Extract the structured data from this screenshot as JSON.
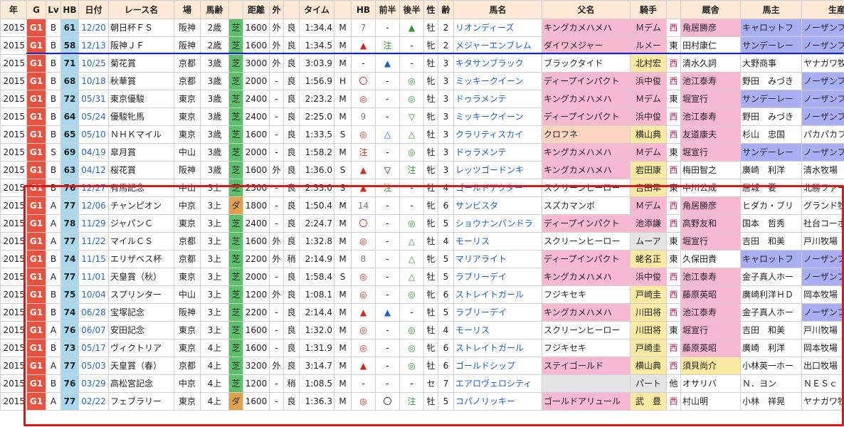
{
  "headers": [
    "年",
    "G",
    "Lv",
    "HB",
    "日付",
    "レース名",
    "場",
    "馬齢",
    "",
    "距離",
    "外",
    "",
    "タイム",
    "",
    "HB",
    "前半",
    "後半",
    "性",
    "齢",
    "馬名",
    "父名",
    "騎手",
    "",
    "厩舎",
    "馬主",
    "生産"
  ],
  "rows": [
    [
      "2015",
      "G1",
      "B",
      "61",
      "12/20",
      "朝日杯ＦＳ",
      "阪神",
      "2歳",
      "芝",
      "1600",
      "外",
      "良",
      "1:34.4",
      "M",
      "7",
      "-",
      "▲",
      "牡",
      "2",
      "リオンディーズ",
      "キングカメハメハ",
      "Ｍデム",
      "西",
      "角居勝彦",
      "キャロットフ",
      "ノーザンファ"
    ],
    [
      "2015",
      "G1",
      "B",
      "58",
      "12/13",
      "阪神ＪＦ",
      "阪神",
      "2歳",
      "芝",
      "1600",
      "外",
      "良",
      "1:34.5",
      "M",
      "▲",
      "注",
      "-",
      "牝",
      "2",
      "メジャーエンブレム",
      "ダイワメジャー",
      "ルメー",
      "東",
      "田村康仁",
      "サンデーレー",
      "ノーザンファ"
    ],
    [
      "2015",
      "G1",
      "B",
      "71",
      "10/25",
      "菊花賞",
      "京都",
      "3歳",
      "芝",
      "3000",
      "外",
      "良",
      "3:03.9",
      "M",
      "-",
      "▲",
      "-",
      "牡",
      "3",
      "キタサンブラック",
      "ブラックタイド",
      "北村宏",
      "西",
      "清水久詞",
      "大野商事",
      "ヤナガワ牧場"
    ],
    [
      "2015",
      "G1",
      "B",
      "68",
      "10/18",
      "秋華賞",
      "京都",
      "3歳",
      "芝",
      "2000",
      "-",
      "良",
      "1:56.9",
      "H",
      "〇",
      "-",
      "◎",
      "牝",
      "3",
      "ミッキークイーン",
      "ディープインパクト",
      "浜中俊",
      "西",
      "池江泰寿",
      "野田　みづき",
      "ノーザンファ"
    ],
    [
      "2015",
      "G1",
      "B",
      "72",
      "05/31",
      "東京優駿",
      "東京",
      "3歳",
      "芝",
      "2400",
      "-",
      "良",
      "2:23.2",
      "M",
      "◎",
      "-",
      "◎",
      "牡",
      "3",
      "ドゥラメンテ",
      "キングカメハメハ",
      "Ｍデム",
      "東",
      "堀宣行",
      "サンデーレー",
      "ノーザンファ"
    ],
    [
      "2015",
      "G1",
      "B",
      "64",
      "05/24",
      "優駿牝馬",
      "東京",
      "3歳",
      "芝",
      "2400",
      "-",
      "良",
      "2:25.0",
      "M",
      "9",
      "-",
      "▽",
      "牝",
      "3",
      "ミッキークイーン",
      "ディープインパクト",
      "浜中俊",
      "西",
      "池江泰寿",
      "野田　みづき",
      "ノーザンファ"
    ],
    [
      "2015",
      "G1",
      "B",
      "65",
      "05/10",
      "ＮＨＫマイル",
      "東京",
      "3歳",
      "芝",
      "1600",
      "-",
      "良",
      "1:33.5",
      "S",
      "◎",
      "△",
      "△",
      "牡",
      "3",
      "クラリティスカイ",
      "クロフネ",
      "横山典",
      "西",
      "友道康夫",
      "杉山　忠国",
      "パカパカファ"
    ],
    [
      "2015",
      "G1",
      "S",
      "69",
      "04/19",
      "皐月賞",
      "中山",
      "3歳",
      "芝",
      "2000",
      "-",
      "良",
      "1:58.2",
      "M",
      "注",
      "-",
      "◎",
      "牡",
      "3",
      "ドゥラメンテ",
      "キングカメハメハ",
      "Ｍデム",
      "東",
      "堀宣行",
      "サンデーレー",
      "ノーザンファ"
    ],
    [
      "2015",
      "G1",
      "B",
      "63",
      "04/12",
      "桜花賞",
      "阪神",
      "3歳",
      "芝",
      "1600",
      "外",
      "良",
      "1:36.0",
      "S",
      "▲",
      "▽",
      "注",
      "牝",
      "3",
      "レッツゴードンキ",
      "キングカメハメハ",
      "岩田康",
      "西",
      "梅田智之",
      "廣崎　利洋",
      "清水牧場"
    ],
    [
      "2015",
      "G1",
      "B",
      "76",
      "12/27",
      "有馬記念",
      "中山",
      "3上",
      "芝",
      "2500",
      "-",
      "良",
      "2:33.0",
      "S",
      "▲",
      "注",
      "-",
      "牡",
      "4",
      "ゴールドアクター",
      "スクリーンヒーロー",
      "吉田隼",
      "東",
      "中川公成",
      "居城　要",
      "北勝ファーム"
    ],
    [
      "2015",
      "G1",
      "A",
      "77",
      "12/06",
      "チャンピオン",
      "中京",
      "3上",
      "ダ",
      "1800",
      "-",
      "良",
      "1:50.4",
      "M",
      "14",
      "-",
      "-",
      "牝",
      "6",
      "サンビスタ",
      "スズカマンボ",
      "Ｍデム",
      "西",
      "角居勝彦",
      "ヒダカ・ブリ",
      "グランド牧場"
    ],
    [
      "2015",
      "G1",
      "A",
      "78",
      "11/29",
      "ジャパンＣ",
      "東京",
      "3上",
      "芝",
      "2400",
      "-",
      "良",
      "2:24.7",
      "M",
      "〇",
      "-",
      "◎",
      "牝",
      "5",
      "ショウナンパンドラ",
      "ディープインパクト",
      "池添謙",
      "西",
      "高野友和",
      "国本　哲秀",
      "社台コーポレ"
    ],
    [
      "2015",
      "G1",
      "A",
      "77",
      "11/22",
      "マイルＣＳ",
      "京都",
      "3上",
      "芝",
      "1600",
      "外",
      "良",
      "1:32.8",
      "M",
      "◎",
      "-",
      "△",
      "牡",
      "4",
      "モーリス",
      "スクリーンヒーロー",
      "ムーア",
      "東",
      "堀宣行",
      "吉田　和美",
      "戸川牧場"
    ],
    [
      "2015",
      "G1",
      "B",
      "74",
      "11/15",
      "エリザベス杯",
      "京都",
      "3上",
      "芝",
      "2200",
      "外",
      "稍",
      "2:14.9",
      "M",
      "8",
      "-",
      "△",
      "牝",
      "5",
      "マリアライト",
      "ディープインパクト",
      "蛯名正",
      "東",
      "久保田貴",
      "キャロットフ",
      "ノーザンファ"
    ],
    [
      "2015",
      "G1",
      "A",
      "77",
      "11/01",
      "天皇賞（秋）",
      "東京",
      "3上",
      "芝",
      "2000",
      "-",
      "良",
      "1:58.4",
      "S",
      "◎",
      "-",
      "△",
      "牡",
      "5",
      "ラブリーデイ",
      "キングカメハメハ",
      "浜中俊",
      "西",
      "池江泰寿",
      "金子真人ホー",
      "ノーザンファ"
    ],
    [
      "2015",
      "G1",
      "B",
      "75",
      "10/04",
      "スプリンター",
      "中山",
      "3上",
      "芝",
      "1200",
      "外",
      "良",
      "1:08.1",
      "M",
      "◎",
      "-",
      "◎",
      "牝",
      "6",
      "ストレイトガール",
      "フジキセキ",
      "戸崎圭",
      "西",
      "藤原英昭",
      "廣崎利洋ＨＤ",
      "岡本牧場"
    ],
    [
      "2015",
      "G1",
      "B",
      "74",
      "06/28",
      "宝塚記念",
      "阪神",
      "3上",
      "芝",
      "2200",
      "-",
      "良",
      "2:14.4",
      "M",
      "▲",
      "▲",
      "-",
      "牡",
      "5",
      "ラブリーデイ",
      "キングカメハメハ",
      "川田将",
      "西",
      "池江泰寿",
      "金子真人ホー",
      "ノーザンファ"
    ],
    [
      "2015",
      "G1",
      "A",
      "76",
      "06/07",
      "安田記念",
      "東京",
      "3上",
      "芝",
      "1600",
      "-",
      "良",
      "1:32.0",
      "M",
      "◎",
      "-",
      "◎",
      "牡",
      "4",
      "モーリス",
      "スクリーンヒーロー",
      "川田将",
      "東",
      "堀宣行",
      "吉田　和美",
      "戸川牧場"
    ],
    [
      "2015",
      "G1",
      "B",
      "73",
      "05/17",
      "ヴィクトリア",
      "東京",
      "4上",
      "芝",
      "1600",
      "-",
      "良",
      "1:31.9",
      "M",
      "◎",
      "-",
      "◎",
      "牝",
      "6",
      "ストレイトガール",
      "フジキセキ",
      "戸崎圭",
      "西",
      "藤原英昭",
      "廣崎　利洋",
      "岡本牧場"
    ],
    [
      "2015",
      "G1",
      "A",
      "77",
      "05/03",
      "天皇賞（春）",
      "京都",
      "4上",
      "芝",
      "3200",
      "外",
      "良",
      "3:14.7",
      "M",
      "▲",
      "-",
      "◎",
      "牡",
      "6",
      "ゴールドシップ",
      "ステイゴールド",
      "横山典",
      "西",
      "須貝尚介",
      "小林英一ホー",
      "出口牧場"
    ],
    [
      "2015",
      "G1",
      "B",
      "76",
      "03/29",
      "高松宮記念",
      "中京",
      "4上",
      "芝",
      "1200",
      "-",
      "稍",
      "1:08.5",
      "M",
      "-",
      "-",
      "-",
      "セ",
      "7",
      "エアロヴェロシティ",
      "",
      "パート",
      "他",
      "オサリバ",
      "Ｎ．ヨン",
      "ＮＥＳｃ"
    ],
    [
      "2015",
      "G1",
      "A",
      "77",
      "02/22",
      "フェブラリー",
      "東京",
      "4上",
      "ダ",
      "1600",
      "-",
      "良",
      "1:36.3",
      "M",
      "◎",
      "〇",
      "注",
      "牡",
      "5",
      "コパノリッキー",
      "ゴールドアリュール",
      "武　豊",
      "西",
      "村山明",
      "小林　祥晃",
      "ヤナガワ牧場"
    ]
  ],
  "colors": {
    "g1": "#e8513e",
    "hb": "#a9d7ee",
    "turf": "#5bbf6b",
    "dirt": "#e3a04b",
    "header": "#fde9d6",
    "highlight_box": "#e01616",
    "separator": "#1a27c8"
  }
}
